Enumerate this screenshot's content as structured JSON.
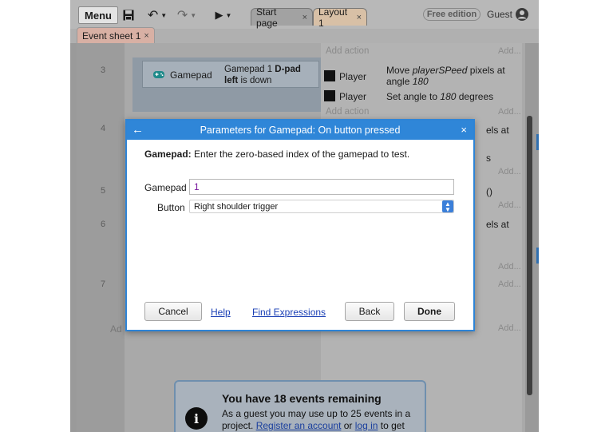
{
  "toolbar": {
    "menu_label": "Menu",
    "tabs": [
      {
        "label": "Start page",
        "close": "×"
      },
      {
        "label": "Layout 1",
        "close": "×"
      }
    ],
    "free_edition": "Free edition",
    "guest": "Guest"
  },
  "sheet_tab": {
    "label": "Event sheet 1",
    "close": "×"
  },
  "events": {
    "row_numbers": [
      "3",
      "4",
      "5",
      "6",
      "7"
    ],
    "condition": {
      "object": "Gamepad",
      "text_prefix": "Gamepad 1 ",
      "text_bold": "D-pad left",
      "text_suffix": " is down"
    },
    "add_action": "Add action",
    "add": "Add...",
    "actions": [
      {
        "object": "Player",
        "line1_prefix": "Move ",
        "line1_em": "playerSPeed",
        "line1_suffix": " pixels at",
        "line2_prefix": "angle ",
        "line2_em": "180"
      },
      {
        "object": "Player",
        "prefix": "Set angle to ",
        "em": "180",
        "suffix": " degrees"
      }
    ],
    "fragments": {
      "f1": "els at",
      "f2": "s",
      "f3": "()",
      "f4": "els at",
      "left_ad": "Ad"
    }
  },
  "notice": {
    "title": "You have 18 events remaining",
    "line1": "As a guest you may use up to 25 events in a",
    "line2_prefix": "project. ",
    "register_link": "Register an account",
    "or": " or ",
    "login_link": "log in",
    "line2_suffix": " to get"
  },
  "dialog": {
    "back": "←",
    "title": "Parameters for Gamepad: On button pressed",
    "close": "×",
    "desc_bold": "Gamepad:",
    "desc_text": " Enter the zero-based index of the gamepad to test.",
    "gamepad_label": "Gamepad",
    "gamepad_value": "1",
    "button_label": "Button",
    "button_value": "Right shoulder trigger",
    "cancel": "Cancel",
    "help": "Help",
    "find_expressions": "Find Expressions",
    "back_button": "Back",
    "done": "Done"
  }
}
